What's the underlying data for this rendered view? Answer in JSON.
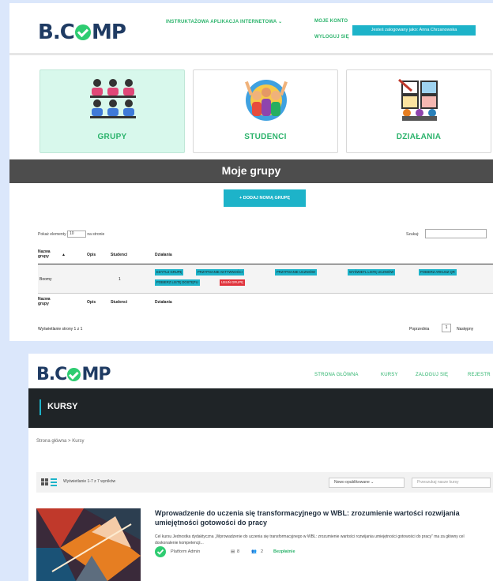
{
  "top_panel": {
    "logo": "B.COMP",
    "nav": {
      "apps": "INSTRUKTAŻOWA APLIKACJA INTERNETOWA ⌄",
      "account": "MOJE KONTO",
      "logout": "WYLOGUJ SIĘ"
    },
    "user_badge": "Jesteś zalogowany jako: Anna Chrzanowska",
    "categories": [
      {
        "label": "GRUPY",
        "icon": "people-group-icon"
      },
      {
        "label": "STUDENCI",
        "icon": "students-icon"
      },
      {
        "label": "DZIAŁANIA",
        "icon": "activities-icon"
      }
    ],
    "banner_title": "Moje grupy",
    "add_group_button": "+ DODAJ NOWĄ GRUPĘ",
    "show_label_pre": "Pokaż elementy",
    "show_value": "10",
    "show_label_post": "na stronie",
    "search_label": "Szukaj:",
    "table": {
      "columns": [
        "Nazwa grupy",
        "Opis",
        "Studenci",
        "Działania"
      ],
      "rows": [
        {
          "name": "Boomy",
          "desc": "",
          "students": "1"
        }
      ],
      "actions": [
        {
          "label": "EDYTUJ GRUPĘ",
          "color": "#1db3c9"
        },
        {
          "label": "PRZYPISANIE AKTYWNOŚCI",
          "color": "#1db3c9"
        },
        {
          "label": "PRZYPISANIE UCZNIÓW",
          "color": "#1db3c9"
        },
        {
          "label": "WYŚWIETL LISTĘ UCZNIÓW",
          "color": "#1db3c9"
        },
        {
          "label": "POBIERZ ARKUSZ QR",
          "color": "#1db3c9"
        },
        {
          "label": "POBIERZ LISTĘ DOSTĘPU",
          "color": "#1db3c9"
        },
        {
          "label": "USUŃ GRUPĘ",
          "color": "#e0333c"
        }
      ]
    },
    "footer_info": "Wyświetlanie strony 1 z 1",
    "prev": "Poprzednia",
    "page": "1",
    "next": "Następny"
  },
  "bottom_panel": {
    "logo": "B.COMP",
    "nav": [
      "STRONA GŁÓWNA",
      "KURSY",
      "ZALOGUJ SIĘ",
      "REJESTR"
    ],
    "section_title": "KURSY",
    "breadcrumb": "Strona główna  >  Kursy",
    "results": "Wyświetlanie 1-7 z 7 wyników",
    "sort": "Nowo opublikowane  ⌄",
    "search_placeholder": "Przeszukaj nasze kursy",
    "course": {
      "title": "Wprowadzenie do uczenia się transformacyjnego w WBL: zrozumienie wartości rozwijania umiejętności gotowości do pracy",
      "desc": "Cel kursu Jednostka dydaktyczna „Wprowadzenie do uczenia się transformacyjnego w WBL: zrozumienie wartości rozwijania umiejętności gotowości do pracy” ma za główny cel doskonalenie kompetencji...",
      "author": "Platform Admin",
      "lessons": "8",
      "students": "2",
      "price": "Bezpłatnie"
    }
  }
}
